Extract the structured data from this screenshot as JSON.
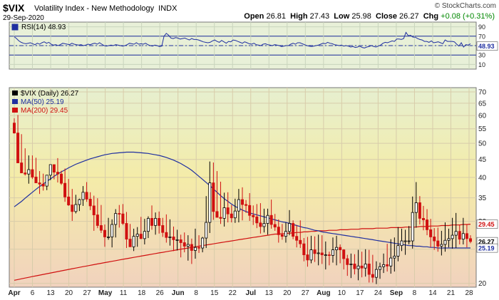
{
  "header": {
    "symbol": "$VIX",
    "name": "Volatility Index - New Methodology",
    "exchange": "INDX",
    "date": "29-Sep-2020",
    "credit": "© StockCharts.com",
    "open_label": "Open",
    "open": "26.81",
    "high_label": "High",
    "high": "27.43",
    "low_label": "Low",
    "low": "25.98",
    "close_label": "Close",
    "close": "26.27",
    "chg_label": "Chg",
    "chg": "+0.08 (+0.31%)"
  },
  "chart_data": [
    {
      "type": "line",
      "panel": "indicator",
      "legend": "RSI(14) 48.93",
      "ylim": [
        0,
        100
      ],
      "yticks": [
        10,
        30,
        50,
        70,
        90
      ],
      "bands": [
        30,
        70
      ],
      "last_value_label": "48.93",
      "colors": {
        "line": "#1f2fa0",
        "band": "#1f2fa0",
        "bg": "#e6efd8"
      },
      "series": [
        {
          "values": [
            69,
            65,
            60,
            57,
            55,
            54,
            55,
            56,
            54,
            52,
            55,
            53,
            56,
            58,
            55,
            57,
            53,
            51,
            52,
            50,
            52,
            55,
            54,
            53,
            52,
            55,
            53,
            52,
            51,
            52,
            50,
            51,
            53,
            52,
            54,
            55,
            53,
            56,
            53,
            50,
            49,
            50,
            51,
            50,
            52,
            51,
            50,
            49,
            50,
            52,
            55,
            54,
            53,
            56,
            53,
            54,
            53,
            55,
            52,
            50,
            49,
            51,
            50,
            48,
            49,
            70,
            76,
            72,
            66,
            65,
            67,
            66,
            64,
            65,
            66,
            64,
            62,
            65,
            63,
            63,
            62,
            60,
            58,
            57,
            56,
            57,
            60,
            62,
            59,
            57,
            61,
            58,
            55,
            59,
            58,
            62,
            61,
            59,
            57,
            55,
            58,
            56,
            54,
            53,
            55,
            52,
            51,
            50,
            53,
            54,
            52,
            51,
            50,
            52,
            51,
            50,
            48,
            49,
            50,
            50,
            53,
            55,
            53,
            56,
            56,
            54,
            52,
            50,
            49,
            48,
            49,
            50,
            51,
            53,
            55,
            54,
            57,
            55,
            54,
            52,
            51,
            50,
            51,
            49,
            50,
            49,
            47,
            48,
            46,
            47,
            49,
            46,
            45,
            47,
            48,
            50,
            48,
            47,
            49,
            51,
            55,
            57,
            56,
            58,
            60,
            59,
            64,
            64,
            63,
            65,
            78,
            71,
            72,
            68,
            68,
            65,
            63,
            62,
            59,
            59,
            57,
            60,
            56,
            57,
            58,
            56,
            54,
            62,
            59,
            59,
            59,
            58,
            53,
            49,
            56,
            47,
            52,
            51,
            54
          ]
        }
      ]
    },
    {
      "type": "candlestick",
      "panel": "price",
      "legend": [
        {
          "text": "$VIX (Daily) 26.27",
          "color": "#000000"
        },
        {
          "text": "MA(50) 25.19",
          "color": "#1f2fa0"
        },
        {
          "text": "MA(200) 29.45",
          "color": "#d01010"
        }
      ],
      "y_scale": "log",
      "ylim": [
        19.5,
        72
      ],
      "yticks": [
        20,
        25,
        30,
        35,
        40,
        45,
        50,
        55,
        60,
        65,
        70
      ],
      "x_ticks": [
        "Apr",
        "6",
        "13",
        "20",
        "27",
        "May",
        "11",
        "18",
        "26",
        "Jun",
        "8",
        "15",
        "22",
        "Jul",
        "13",
        "20",
        "27",
        "Aug",
        "10",
        "17",
        "24",
        "Sep",
        "8",
        "14",
        "21",
        "28"
      ],
      "x_tick_bold": [
        "Apr",
        "May",
        "Jun",
        "Jul",
        "Aug",
        "Sep"
      ],
      "last_price_labels": {
        "ma200": "29.45",
        "close": "26.27",
        "ma50": "25.19"
      },
      "colors": {
        "up": "#000000",
        "down": "#d01010",
        "ma50": "#1f2fa0",
        "ma200": "#d01010",
        "bg_top": "#f4eca8",
        "bg_bottom": "#f1d8c0"
      },
      "series": [
        {
          "name": "Open",
          "values": [
            57.1,
            53.5,
            44.0,
            41.2,
            40.9,
            42.1,
            40.1,
            38.6,
            38.3,
            37.8,
            40.6,
            43.5,
            41.4,
            40.9,
            38.5,
            35.2,
            33.4,
            32.0,
            33.5,
            34.6,
            36.3,
            34.7,
            33.2,
            31.3,
            29.2,
            28.3,
            27.1,
            27.1,
            29.4,
            31.6,
            31.5,
            29.6,
            26.7,
            25.4,
            27.2,
            27.6,
            26.8,
            28.1,
            30.6,
            29.2,
            30.6,
            29.2,
            27.9,
            27.0,
            27.1,
            26.6,
            26.6,
            26.1,
            25.5,
            25.8,
            24.8,
            25.3,
            25.2,
            26.9,
            29.8,
            38.6,
            32.0,
            30.8,
            30.6,
            32.8,
            31.5,
            30.7,
            32.1,
            34.6,
            33.5,
            33.3,
            31.2,
            30.9,
            29.7,
            29.0,
            29.6,
            31.2,
            29.4,
            28.9,
            27.5,
            27.2,
            28.1,
            29.6,
            27.2,
            26.5,
            25.9,
            24.1,
            23.3,
            24.9,
            24.3,
            24.4,
            24.1,
            24.1,
            24.0,
            24.9,
            25.3,
            24.9,
            23.5,
            22.6,
            22.7,
            22.0,
            22.4,
            22.1,
            22.7,
            21.2,
            20.8,
            21.9,
            22.3,
            22.6,
            22.4,
            23.6,
            23.9,
            25.6,
            26.4,
            26.4,
            26.4,
            31.8,
            33.9,
            30.6,
            30.3,
            28.4,
            27.1,
            26.4,
            25.5,
            25.8,
            26.5,
            26.8,
            27.4,
            28.1,
            26.7,
            27.7,
            26.8
          ]
        },
        {
          "name": "High",
          "values": [
            58.9,
            60.2,
            53.1,
            48.4,
            46.2,
            46.2,
            45.5,
            41.7,
            41.0,
            40.2,
            42.5,
            43.2,
            45.4,
            41.8,
            42.4,
            39.6,
            37.1,
            35.7,
            34.8,
            37.8,
            38.8,
            36.3,
            35.5,
            34.9,
            33.4,
            29.4,
            30.7,
            30.4,
            32.5,
            33.4,
            33.6,
            31.9,
            29.5,
            28.6,
            28.9,
            30.9,
            30.5,
            31.0,
            33.3,
            31.8,
            32.0,
            30.7,
            31.4,
            30.4,
            29.0,
            28.4,
            27.5,
            27.9,
            27.4,
            26.8,
            28.6,
            27.4,
            27.1,
            35.4,
            44.4,
            44.1,
            41.7,
            38.9,
            36.2,
            36.3,
            33.4,
            34.8,
            37.1,
            37.5,
            34.5,
            36.1,
            33.3,
            33.6,
            33.8,
            32.6,
            32.6,
            34.6,
            31.5,
            30.4,
            29.5,
            29.8,
            32.3,
            30.2,
            29.3,
            30.2,
            26.9,
            27.1,
            27.3,
            27.2,
            27.5,
            27.4,
            26.3,
            24.6,
            27.0,
            27.3,
            25.8,
            25.0,
            24.1,
            24.3,
            24.2,
            24.9,
            24.6,
            25.0,
            24.9,
            24.1,
            23.1,
            22.9,
            24.3,
            25.9,
            26.7,
            27.0,
            28.9,
            28.6,
            28.4,
            29.1,
            35.3,
            38.8,
            35.4,
            33.2,
            32.5,
            30.5,
            28.7,
            28.8,
            28.2,
            29.8,
            28.6,
            30.7,
            31.7,
            29.4,
            30.7,
            29.4,
            27.4
          ]
        },
        {
          "name": "Low",
          "values": [
            53.3,
            47.4,
            41.7,
            40.5,
            38.4,
            39.6,
            38.7,
            35.9,
            36.7,
            36.8,
            39.3,
            39.5,
            38.7,
            38.1,
            34.1,
            33.2,
            30.1,
            31.6,
            32.1,
            33.2,
            34.1,
            32.3,
            28.2,
            28.7,
            27.8,
            25.4,
            26.6,
            25.3,
            27.0,
            28.8,
            29.3,
            25.2,
            25.7,
            24.7,
            25.4,
            26.7,
            25.8,
            26.9,
            28.4,
            27.5,
            27.7,
            27.1,
            26.1,
            25.6,
            24.7,
            24.8,
            23.7,
            24.5,
            23.2,
            22.7,
            23.5,
            24.4,
            24.5,
            25.2,
            27.8,
            30.3,
            31.0,
            29.5,
            29.0,
            29.8,
            29.8,
            29.7,
            29.8,
            30.2,
            31.7,
            30.1,
            29.3,
            28.7,
            27.7,
            27.9,
            27.5,
            28.6,
            28.2,
            26.1,
            26.6,
            26.1,
            27.4,
            26.7,
            25.3,
            25.2,
            23.1,
            22.3,
            22.8,
            23.0,
            22.5,
            22.7,
            21.9,
            22.5,
            22.9,
            22.5,
            22.8,
            21.9,
            21.0,
            20.7,
            21.2,
            20.4,
            20.8,
            20.9,
            20.1,
            20.1,
            19.9,
            20.6,
            21.4,
            21.6,
            21.3,
            21.6,
            23.1,
            24.7,
            24.1,
            25.8,
            25.1,
            28.8,
            29.4,
            28.3,
            27.4,
            25.3,
            24.9,
            24.6,
            24.0,
            24.6,
            25.3,
            25.1,
            25.2,
            25.8,
            25.8,
            25.3,
            26.0
          ]
        },
        {
          "name": "Close",
          "values": [
            53.5,
            44.0,
            41.2,
            40.9,
            42.1,
            40.1,
            38.6,
            38.3,
            37.8,
            40.6,
            43.5,
            41.4,
            40.9,
            38.5,
            35.2,
            33.4,
            32.0,
            33.5,
            34.6,
            36.3,
            34.7,
            33.2,
            31.3,
            29.2,
            28.3,
            27.1,
            27.1,
            29.4,
            31.6,
            31.5,
            29.6,
            26.7,
            25.4,
            27.2,
            27.6,
            26.8,
            28.1,
            30.6,
            29.2,
            30.6,
            29.2,
            27.9,
            27.0,
            27.1,
            26.6,
            26.6,
            26.1,
            25.5,
            25.8,
            24.8,
            25.3,
            25.2,
            26.9,
            29.8,
            38.6,
            32.0,
            30.8,
            30.6,
            32.8,
            31.5,
            30.7,
            32.1,
            34.6,
            33.5,
            33.3,
            31.2,
            30.9,
            29.7,
            29.0,
            29.6,
            31.2,
            29.4,
            28.9,
            27.5,
            27.2,
            28.1,
            29.6,
            27.2,
            26.5,
            25.9,
            24.1,
            23.3,
            24.9,
            24.3,
            24.4,
            24.1,
            24.1,
            24.0,
            24.9,
            25.3,
            24.9,
            23.5,
            22.6,
            22.7,
            22.0,
            22.4,
            22.1,
            22.7,
            21.2,
            20.8,
            21.9,
            22.3,
            22.6,
            22.4,
            23.6,
            23.9,
            25.6,
            26.4,
            26.4,
            26.4,
            31.8,
            33.9,
            30.6,
            30.3,
            28.4,
            27.1,
            26.4,
            25.5,
            25.8,
            26.5,
            26.8,
            27.4,
            28.1,
            26.7,
            27.7,
            26.8,
            26.3
          ]
        },
        {
          "name": "MA(50)",
          "values": [
            33.0,
            33.6,
            34.2,
            34.9,
            35.6,
            36.3,
            37.0,
            37.7,
            38.3,
            39.0,
            39.6,
            40.3,
            40.9,
            41.5,
            42.0,
            42.6,
            43.1,
            43.6,
            44.0,
            44.4,
            44.8,
            45.2,
            45.5,
            45.8,
            46.1,
            46.4,
            46.6,
            46.8,
            46.9,
            47.0,
            47.1,
            47.2,
            47.2,
            47.2,
            47.1,
            47.0,
            46.9,
            46.8,
            46.6,
            46.4,
            46.2,
            45.9,
            45.6,
            45.2,
            44.8,
            44.3,
            43.8,
            43.2,
            42.6,
            41.9,
            41.1,
            40.3,
            39.5,
            38.7,
            37.9,
            37.1,
            36.3,
            35.5,
            34.8,
            34.2,
            33.6,
            33.1,
            32.7,
            32.3,
            32.0,
            31.7,
            31.5,
            31.3,
            31.1,
            30.9,
            30.7,
            30.5,
            30.3,
            30.1,
            29.9,
            29.8,
            29.6,
            29.4,
            29.2,
            29.0,
            28.8,
            28.7,
            28.5,
            28.3,
            28.2,
            28.0,
            27.9,
            27.8,
            27.7,
            27.6,
            27.5,
            27.4,
            27.3,
            27.2,
            27.1,
            27.0,
            26.9,
            26.8,
            26.7,
            26.6,
            26.5,
            26.4,
            26.3,
            26.2,
            26.1,
            26.0,
            25.9,
            25.8,
            25.7,
            25.6,
            25.6,
            25.5,
            25.5,
            25.4,
            25.4,
            25.3,
            25.3,
            25.2,
            25.2,
            25.2,
            25.2,
            25.2,
            25.2,
            25.2,
            25.2,
            25.2,
            25.2
          ]
        },
        {
          "name": "MA(200)",
          "values": [
            20.4,
            20.5,
            20.6,
            20.7,
            20.8,
            20.9,
            21.0,
            21.1,
            21.2,
            21.3,
            21.4,
            21.5,
            21.6,
            21.7,
            21.8,
            21.9,
            22.0,
            22.1,
            22.2,
            22.3,
            22.4,
            22.5,
            22.6,
            22.7,
            22.8,
            22.9,
            23.0,
            23.1,
            23.2,
            23.3,
            23.4,
            23.5,
            23.6,
            23.7,
            23.8,
            23.9,
            24.0,
            24.1,
            24.2,
            24.3,
            24.4,
            24.5,
            24.6,
            24.7,
            24.8,
            24.9,
            25.0,
            25.1,
            25.2,
            25.3,
            25.4,
            25.5,
            25.6,
            25.7,
            25.8,
            25.9,
            26.0,
            26.1,
            26.2,
            26.3,
            26.4,
            26.5,
            26.6,
            26.7,
            26.8,
            26.9,
            27.0,
            27.1,
            27.2,
            27.3,
            27.4,
            27.5,
            27.6,
            27.6,
            27.7,
            27.7,
            27.8,
            27.8,
            27.9,
            27.9,
            28.0,
            28.0,
            28.1,
            28.1,
            28.2,
            28.2,
            28.2,
            28.3,
            28.3,
            28.3,
            28.4,
            28.4,
            28.4,
            28.5,
            28.5,
            28.5,
            28.6,
            28.6,
            28.6,
            28.6,
            28.7,
            28.7,
            28.7,
            28.7,
            28.8,
            28.8,
            28.8,
            28.8,
            28.9,
            28.9,
            28.9,
            28.9,
            29.0,
            29.0,
            29.0,
            29.1,
            29.1,
            29.1,
            29.2,
            29.2,
            29.2,
            29.3,
            29.3,
            29.3,
            29.4,
            29.4,
            29.45
          ]
        }
      ]
    }
  ]
}
